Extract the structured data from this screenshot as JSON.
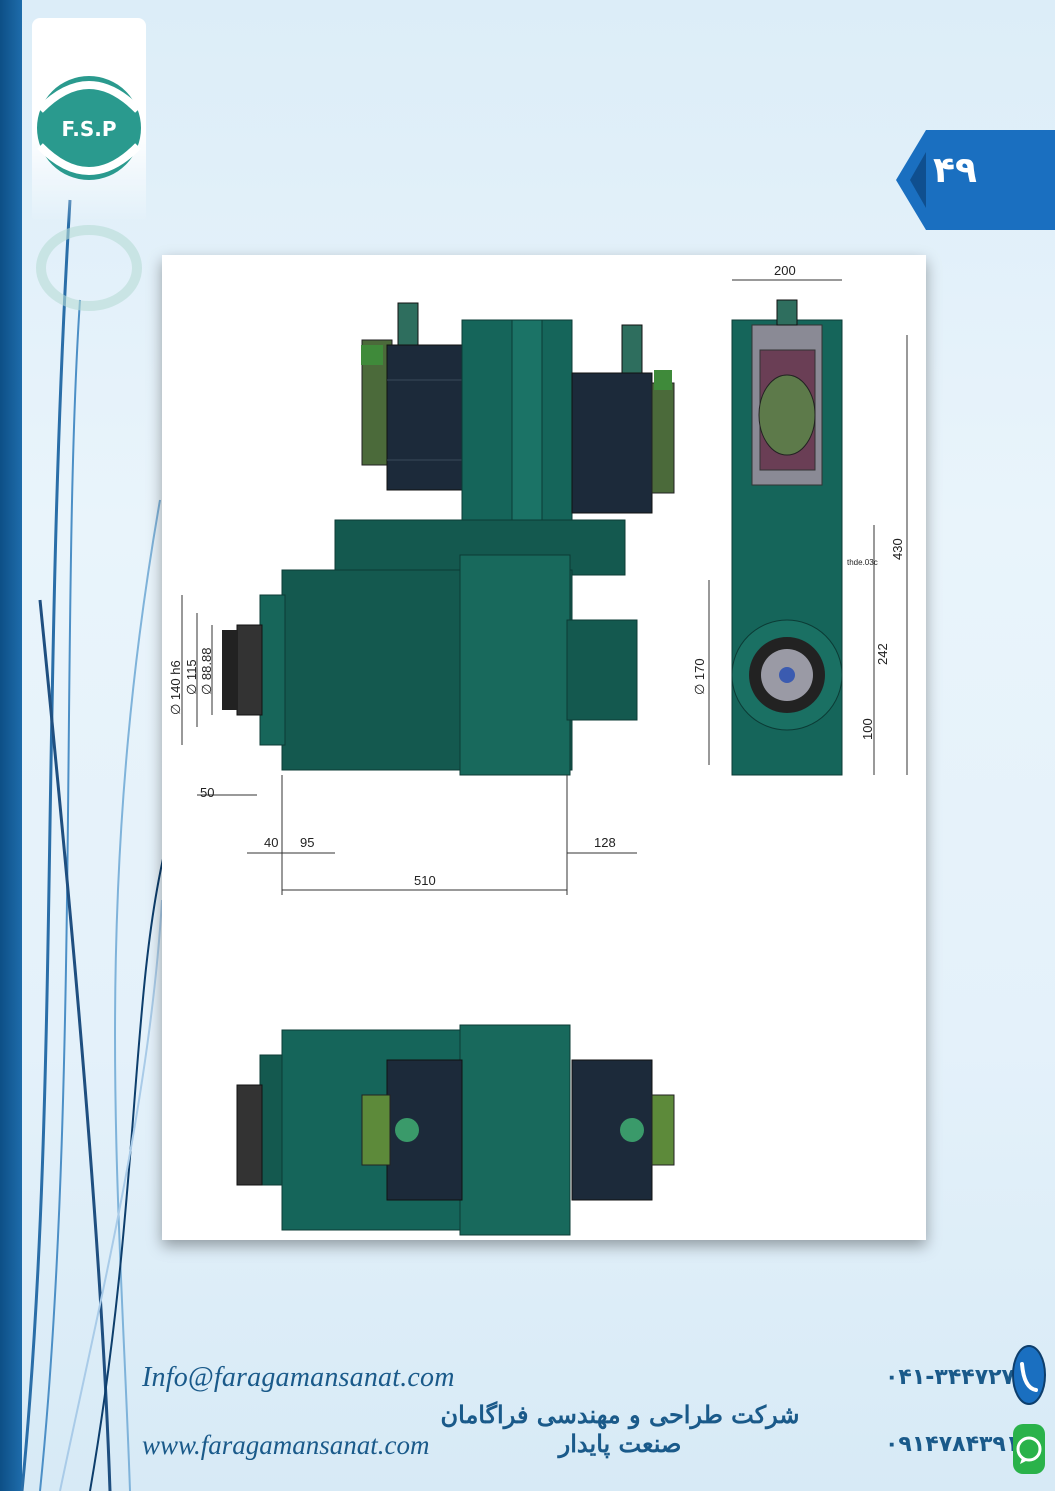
{
  "page": {
    "number": "۴۹",
    "logo_text": "F.S.P",
    "colors": {
      "brand_blue": "#1a6fc0",
      "teal": "#15655a",
      "dark_navy": "#0d4f86"
    }
  },
  "drawing": {
    "dimensions": {
      "width_200": "200",
      "height_430": "430",
      "height_242": "242",
      "height_100": "100",
      "dia_170": "∅ 170",
      "dia_140": "∅ 140 h6",
      "dia_115": "∅ 115",
      "dia_88": "∅ 88.88",
      "len_50": "50",
      "len_40": "40",
      "len_95": "95",
      "len_128": "128",
      "len_510": "510",
      "thread_note": "thde.03c"
    }
  },
  "footer": {
    "email": "Info@faragamansanat.com",
    "website": "www.faragamansanat.com",
    "company": "شرکت طراحی و مهندسی فراگامان صنعت پایدار",
    "phone": "۰۴۱-۳۴۴۷۲۷۴۴",
    "mobile": "۰۹۱۴۷۸۴۳۹۱۹",
    "phone_icon": "phone-icon",
    "whatsapp_icon": "whatsapp-icon"
  }
}
